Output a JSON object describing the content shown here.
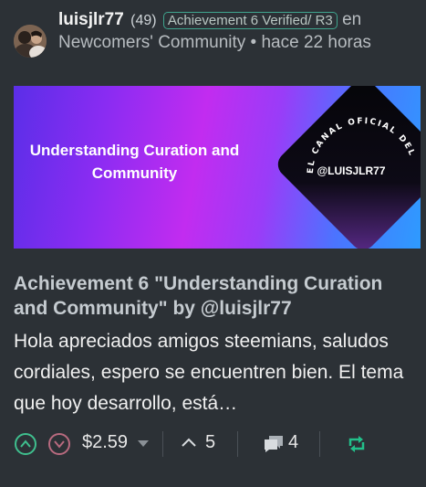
{
  "header": {
    "author": "luisjlr77",
    "reputation": "(49)",
    "badge": "Achievement 6 Verified/ R3",
    "community_line": "en Newcomers' Community • hace 22 horas"
  },
  "banner": {
    "title": "Understanding Curation and Community",
    "stamp_text": "EL CANAL OFICIAL DEL",
    "handle": "@LUISJLR77"
  },
  "post": {
    "title": "Achievement 6 \"Understanding Curation and Community\" by @luisjlr77",
    "excerpt": "Hola apreciados amigos steemians, saludos cordiales, espero se encuentren bien. El tema que hoy desarrollo, está…"
  },
  "footer": {
    "payout": "$2.59",
    "votes": "5",
    "comments": "4"
  },
  "colors": {
    "background": "#2c3136",
    "upvote": "#3fbf8e",
    "downvote": "#b86a7f",
    "reblog": "#22c08a"
  },
  "icons": [
    "upvote-icon",
    "downvote-icon",
    "dropdown-caret-icon",
    "chevron-up-icon",
    "comment-bubbles-icon",
    "reblog-icon"
  ]
}
